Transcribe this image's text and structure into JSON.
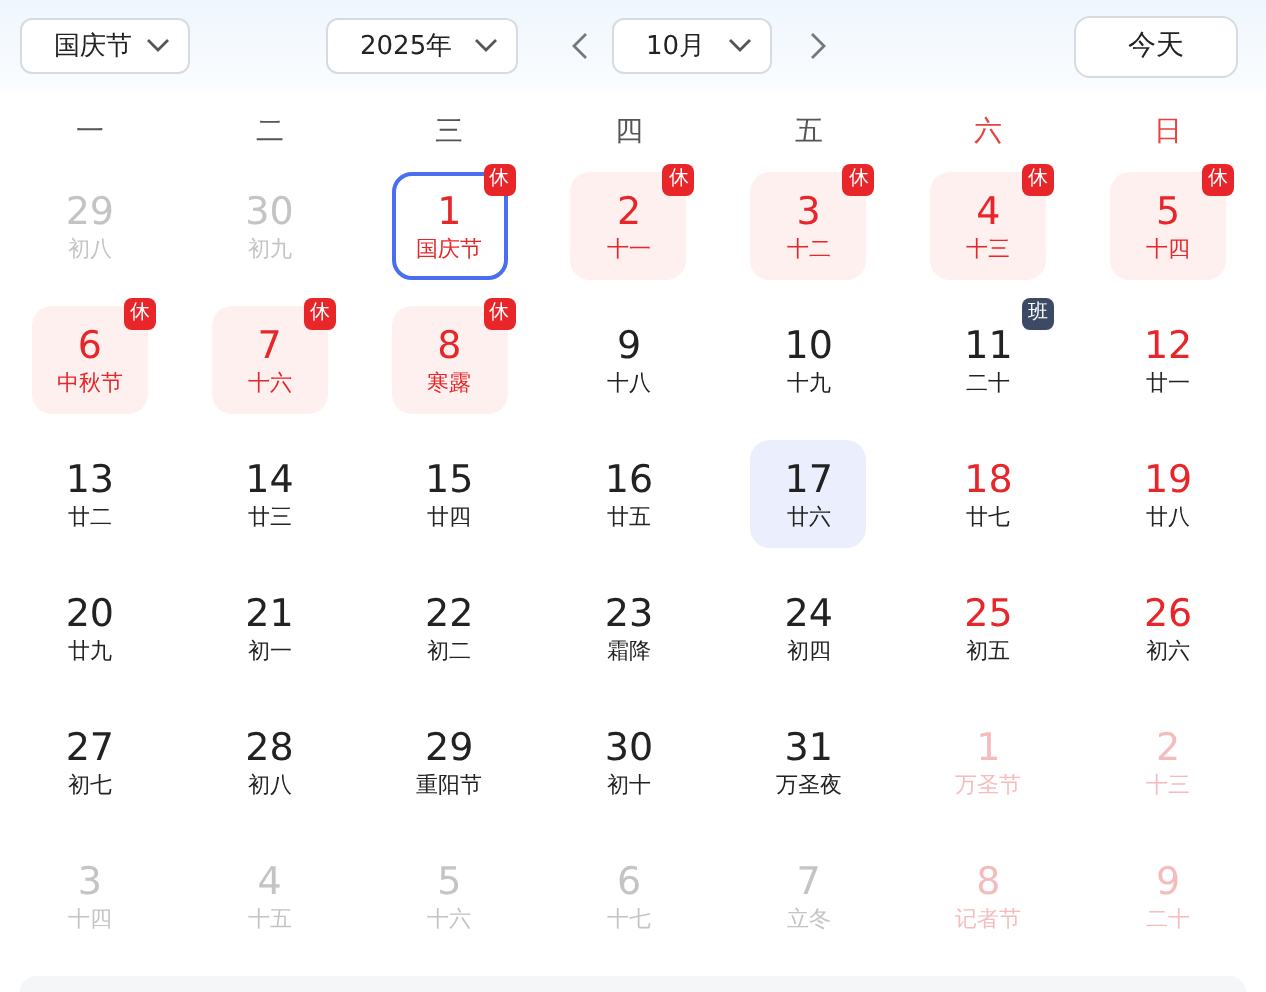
{
  "toolbar": {
    "holiday_select": "国庆节",
    "year_select": "2025年",
    "month_select": "10月",
    "today_button": "今天"
  },
  "weekdays": [
    {
      "label": "一",
      "weekend": false
    },
    {
      "label": "二",
      "weekend": false
    },
    {
      "label": "三",
      "weekend": false
    },
    {
      "label": "四",
      "weekend": false
    },
    {
      "label": "五",
      "weekend": false
    },
    {
      "label": "六",
      "weekend": true
    },
    {
      "label": "日",
      "weekend": true
    }
  ],
  "days": [
    {
      "day": "29",
      "sub": "初八",
      "other_month": true,
      "red": false,
      "holiday": false,
      "selected": false,
      "today": false
    },
    {
      "day": "30",
      "sub": "初九",
      "other_month": true,
      "red": false,
      "holiday": false,
      "selected": false,
      "today": false
    },
    {
      "day": "1",
      "sub": "国庆节",
      "other_month": false,
      "red": true,
      "holiday": true,
      "selected": true,
      "today": false,
      "badge": {
        "text": "休",
        "kind": "rest"
      }
    },
    {
      "day": "2",
      "sub": "十一",
      "other_month": false,
      "red": true,
      "holiday": true,
      "selected": false,
      "today": false,
      "badge": {
        "text": "休",
        "kind": "rest"
      }
    },
    {
      "day": "3",
      "sub": "十二",
      "other_month": false,
      "red": true,
      "holiday": true,
      "selected": false,
      "today": false,
      "badge": {
        "text": "休",
        "kind": "rest"
      }
    },
    {
      "day": "4",
      "sub": "十三",
      "other_month": false,
      "red": true,
      "holiday": true,
      "selected": false,
      "today": false,
      "badge": {
        "text": "休",
        "kind": "rest"
      }
    },
    {
      "day": "5",
      "sub": "十四",
      "other_month": false,
      "red": true,
      "holiday": true,
      "selected": false,
      "today": false,
      "badge": {
        "text": "休",
        "kind": "rest"
      }
    },
    {
      "day": "6",
      "sub": "中秋节",
      "other_month": false,
      "red": true,
      "holiday": true,
      "selected": false,
      "today": false,
      "badge": {
        "text": "休",
        "kind": "rest"
      }
    },
    {
      "day": "7",
      "sub": "十六",
      "other_month": false,
      "red": true,
      "holiday": true,
      "selected": false,
      "today": false,
      "badge": {
        "text": "休",
        "kind": "rest"
      }
    },
    {
      "day": "8",
      "sub": "寒露",
      "other_month": false,
      "red": true,
      "holiday": true,
      "selected": false,
      "today": false,
      "badge": {
        "text": "休",
        "kind": "rest"
      }
    },
    {
      "day": "9",
      "sub": "十八",
      "other_month": false,
      "red": false,
      "holiday": false,
      "selected": false,
      "today": false
    },
    {
      "day": "10",
      "sub": "十九",
      "other_month": false,
      "red": false,
      "holiday": false,
      "selected": false,
      "today": false
    },
    {
      "day": "11",
      "sub": "二十",
      "other_month": false,
      "red": false,
      "holiday": false,
      "selected": false,
      "today": false,
      "badge": {
        "text": "班",
        "kind": "work"
      }
    },
    {
      "day": "12",
      "sub": "廿一",
      "other_month": false,
      "red": true,
      "holiday": false,
      "selected": false,
      "today": false
    },
    {
      "day": "13",
      "sub": "廿二",
      "other_month": false,
      "red": false,
      "holiday": false,
      "selected": false,
      "today": false
    },
    {
      "day": "14",
      "sub": "廿三",
      "other_month": false,
      "red": false,
      "holiday": false,
      "selected": false,
      "today": false
    },
    {
      "day": "15",
      "sub": "廿四",
      "other_month": false,
      "red": false,
      "holiday": false,
      "selected": false,
      "today": false
    },
    {
      "day": "16",
      "sub": "廿五",
      "other_month": false,
      "red": false,
      "holiday": false,
      "selected": false,
      "today": false
    },
    {
      "day": "17",
      "sub": "廿六",
      "other_month": false,
      "red": false,
      "holiday": false,
      "selected": false,
      "today": true
    },
    {
      "day": "18",
      "sub": "廿七",
      "other_month": false,
      "red": true,
      "holiday": false,
      "selected": false,
      "today": false
    },
    {
      "day": "19",
      "sub": "廿八",
      "other_month": false,
      "red": true,
      "holiday": false,
      "selected": false,
      "today": false
    },
    {
      "day": "20",
      "sub": "廿九",
      "other_month": false,
      "red": false,
      "holiday": false,
      "selected": false,
      "today": false
    },
    {
      "day": "21",
      "sub": "初一",
      "other_month": false,
      "red": false,
      "holiday": false,
      "selected": false,
      "today": false
    },
    {
      "day": "22",
      "sub": "初二",
      "other_month": false,
      "red": false,
      "holiday": false,
      "selected": false,
      "today": false
    },
    {
      "day": "23",
      "sub": "霜降",
      "other_month": false,
      "red": false,
      "holiday": false,
      "selected": false,
      "today": false
    },
    {
      "day": "24",
      "sub": "初四",
      "other_month": false,
      "red": false,
      "holiday": false,
      "selected": false,
      "today": false
    },
    {
      "day": "25",
      "sub": "初五",
      "other_month": false,
      "red": true,
      "holiday": false,
      "selected": false,
      "today": false
    },
    {
      "day": "26",
      "sub": "初六",
      "other_month": false,
      "red": true,
      "holiday": false,
      "selected": false,
      "today": false
    },
    {
      "day": "27",
      "sub": "初七",
      "other_month": false,
      "red": false,
      "holiday": false,
      "selected": false,
      "today": false
    },
    {
      "day": "28",
      "sub": "初八",
      "other_month": false,
      "red": false,
      "holiday": false,
      "selected": false,
      "today": false
    },
    {
      "day": "29",
      "sub": "重阳节",
      "other_month": false,
      "red": false,
      "holiday": false,
      "selected": false,
      "today": false
    },
    {
      "day": "30",
      "sub": "初十",
      "other_month": false,
      "red": false,
      "holiday": false,
      "selected": false,
      "today": false
    },
    {
      "day": "31",
      "sub": "万圣夜",
      "other_month": false,
      "red": false,
      "holiday": false,
      "selected": false,
      "today": false
    },
    {
      "day": "1",
      "sub": "万圣节",
      "other_month": true,
      "red": true,
      "holiday": false,
      "selected": false,
      "today": false
    },
    {
      "day": "2",
      "sub": "十三",
      "other_month": true,
      "red": true,
      "holiday": false,
      "selected": false,
      "today": false
    },
    {
      "day": "3",
      "sub": "十四",
      "other_month": true,
      "red": false,
      "holiday": false,
      "selected": false,
      "today": false
    },
    {
      "day": "4",
      "sub": "十五",
      "other_month": true,
      "red": false,
      "holiday": false,
      "selected": false,
      "today": false
    },
    {
      "day": "5",
      "sub": "十六",
      "other_month": true,
      "red": false,
      "holiday": false,
      "selected": false,
      "today": false
    },
    {
      "day": "6",
      "sub": "十七",
      "other_month": true,
      "red": false,
      "holiday": false,
      "selected": false,
      "today": false
    },
    {
      "day": "7",
      "sub": "立冬",
      "other_month": true,
      "red": false,
      "holiday": false,
      "selected": false,
      "today": false
    },
    {
      "day": "8",
      "sub": "记者节",
      "other_month": true,
      "red": true,
      "holiday": false,
      "selected": false,
      "today": false
    },
    {
      "day": "9",
      "sub": "二十",
      "other_month": true,
      "red": true,
      "holiday": false,
      "selected": false,
      "today": false
    }
  ]
}
